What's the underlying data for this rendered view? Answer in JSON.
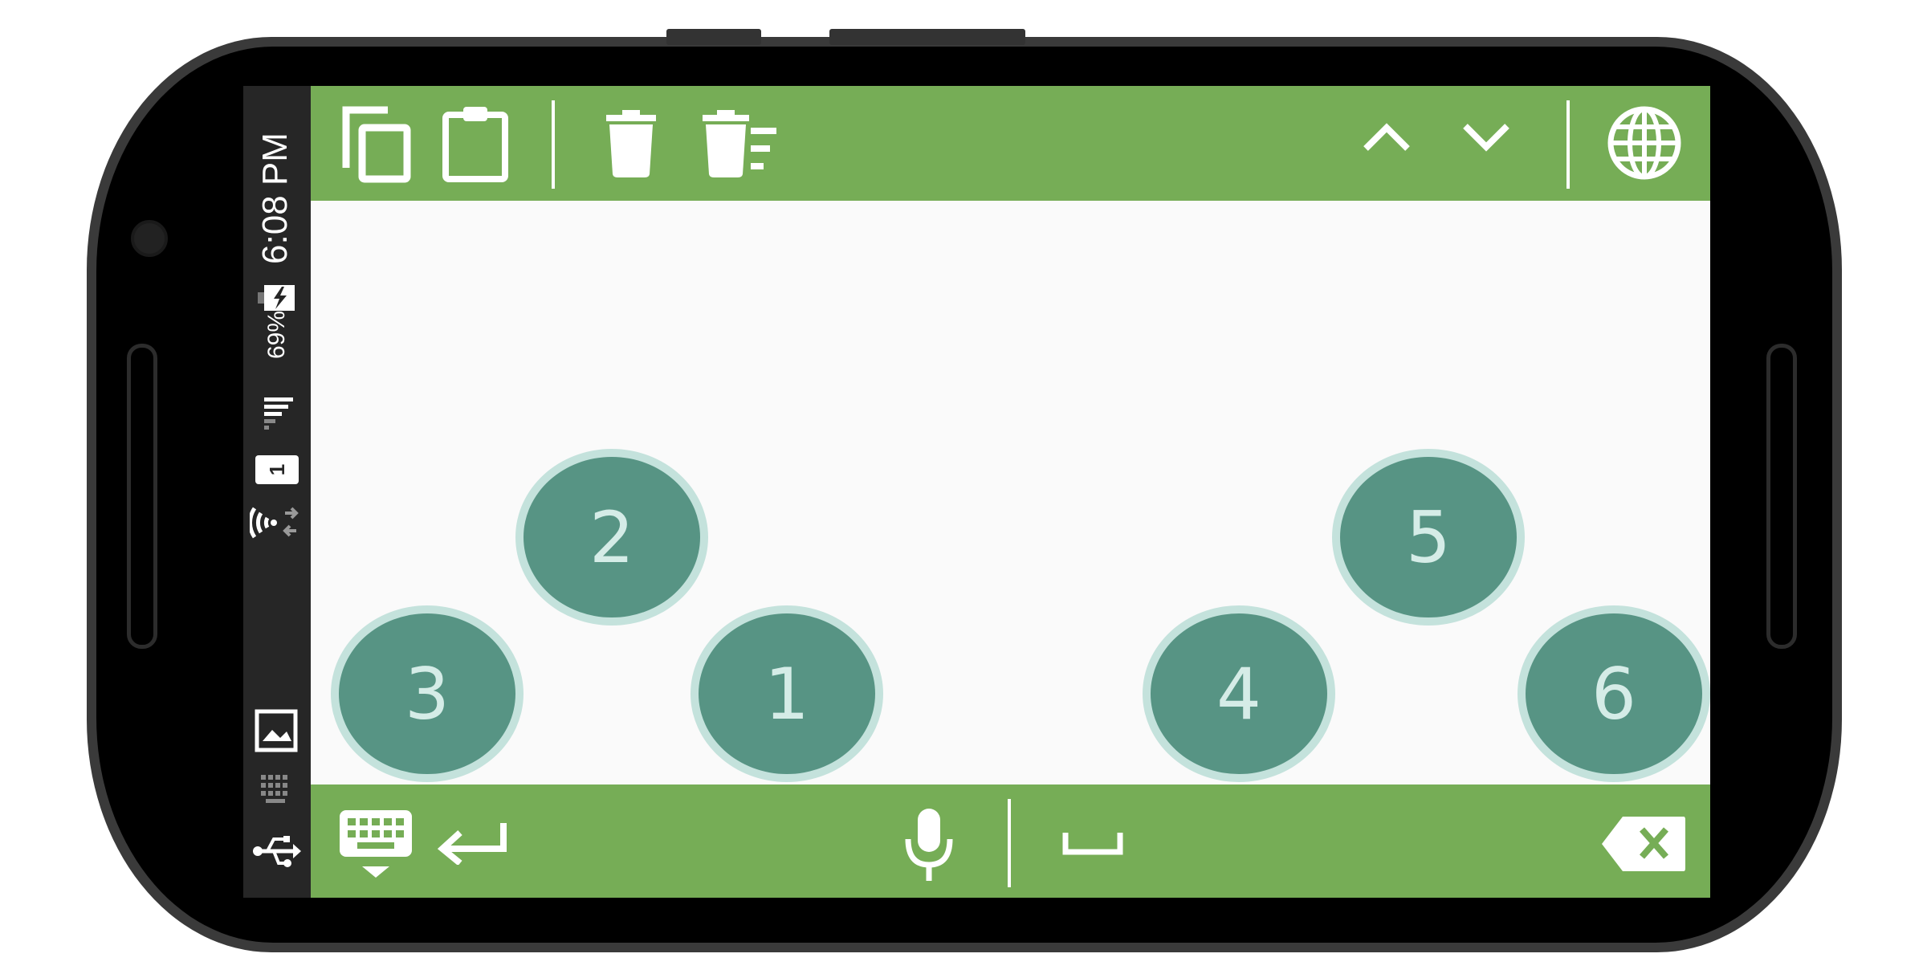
{
  "status_bar": {
    "time": "6:08 PM",
    "battery": "69%",
    "sim_slot": "1"
  },
  "toolbar": {
    "icons": [
      "copy-icon",
      "paste-icon",
      "delete-icon",
      "delete-all-icon",
      "chevron-up-icon",
      "chevron-down-icon",
      "globe-icon"
    ]
  },
  "keys": [
    {
      "label": "1"
    },
    {
      "label": "2"
    },
    {
      "label": "3"
    },
    {
      "label": "4"
    },
    {
      "label": "5"
    },
    {
      "label": "6"
    }
  ],
  "bottom_bar": {
    "icons": [
      "keyboard-hide-icon",
      "enter-icon",
      "microphone-icon",
      "space-icon",
      "backspace-icon"
    ]
  },
  "colors": {
    "bar_green": "#76ad56",
    "key_fill": "#579484",
    "key_ring": "#c4e2dc",
    "screen_bg": "#fafafa",
    "status_bar_bg": "#262626"
  }
}
